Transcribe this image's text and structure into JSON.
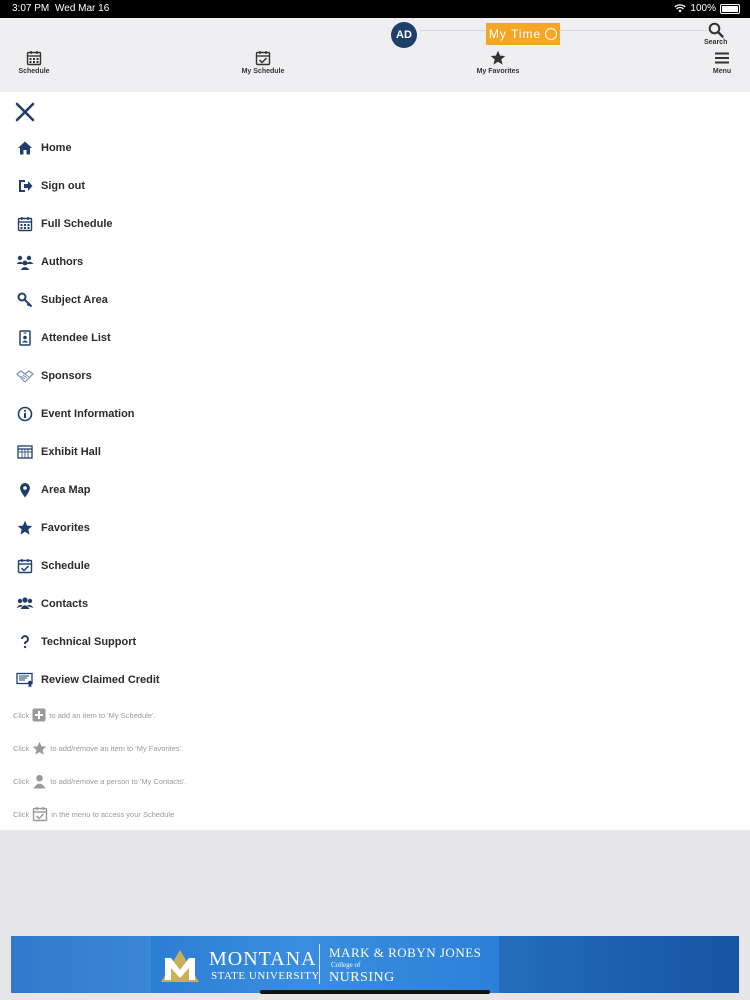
{
  "status": {
    "time": "3:07 PM",
    "date": "Wed Mar 16",
    "battery": "100%"
  },
  "topnav": {
    "schedule_label": "Schedule",
    "my_schedule_label": "My Schedule",
    "my_favorites_label": "My Favorites",
    "menu_label": "Menu",
    "search_label": "Search",
    "avatar_initials": "AD",
    "my_time_label": "My Time"
  },
  "menu": {
    "items": [
      {
        "label": "Home",
        "icon": "home-icon"
      },
      {
        "label": "Sign out",
        "icon": "sign-out-icon"
      },
      {
        "label": "Full Schedule",
        "icon": "calendar-icon"
      },
      {
        "label": "Authors",
        "icon": "authors-icon"
      },
      {
        "label": "Subject Area",
        "icon": "key-icon"
      },
      {
        "label": "Attendee List",
        "icon": "badge-icon"
      },
      {
        "label": "Sponsors",
        "icon": "handshake-icon"
      },
      {
        "label": "Event Information",
        "icon": "info-icon"
      },
      {
        "label": "Exhibit Hall",
        "icon": "exhibit-icon"
      },
      {
        "label": "Area Map",
        "icon": "map-pin-icon"
      },
      {
        "label": "Favorites",
        "icon": "star-icon"
      },
      {
        "label": "Schedule",
        "icon": "calendar-check-icon"
      },
      {
        "label": "Contacts",
        "icon": "contacts-icon"
      },
      {
        "label": "Technical Support",
        "icon": "question-icon"
      },
      {
        "label": "Review Claimed Credit",
        "icon": "certificate-icon"
      }
    ]
  },
  "hints": {
    "h1_pre": "Click",
    "h1_post": "to add an item to 'My Schedule'.",
    "h2_pre": "Click",
    "h2_post": "to add/remove an item to 'My Favorites'.",
    "h3_pre": "Click",
    "h3_post": "to add/remove a person to 'My Contacts'.",
    "h4_pre": "Click",
    "h4_post": "in the menu to access your Schedule"
  },
  "banner": {
    "montana": "MONTANA",
    "msu": "STATE UNIVERSITY",
    "mrj": "MARK & ROBYN JONES",
    "college": "College of",
    "nursing": "NURSING"
  },
  "colors": {
    "accent_navy": "#1f3f6b",
    "my_time_orange": "#f5a623",
    "banner_blue": "#2a7fd6"
  }
}
